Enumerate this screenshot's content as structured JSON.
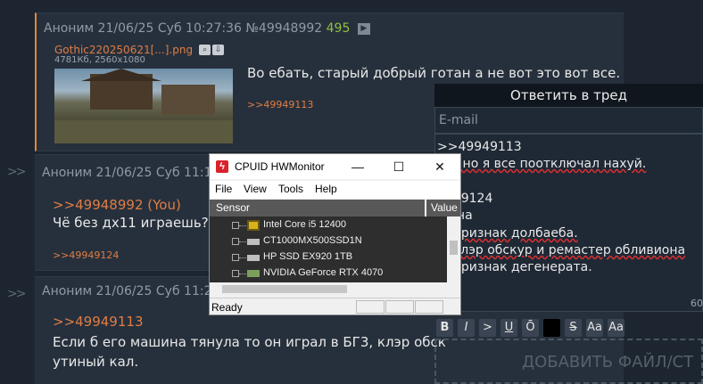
{
  "posts": [
    {
      "header": "Аноним 21/06/25 Суб 10:27:36 №49948992",
      "count": "495",
      "play_icon": "play-icon",
      "file_name": "Gothic220250621[...].png",
      "file_meta": "4781Кб, 2560x1080",
      "message": "Во ебать, старый добрый готан а не вот это вот все.",
      "backlink": ">>49949113"
    },
    {
      "header": "Аноним 21/06/25 Суб 11:16",
      "reply_link": ">>49948992 (You)",
      "message": "Чё без дх11 играешь?",
      "backlink": ">>49949124"
    },
    {
      "header": "Аноним 21/06/25 Суб 11:21",
      "reply_link": ">>49949113",
      "message_line1": "Если б его машина тянула то он играл в БГ3, клэр обск",
      "message_line2": "утиный кал."
    }
  ],
  "reply_form": {
    "title": "Ответить в тред",
    "email_placeholder": "E-mail",
    "text_lines": [
      ">>49949113",
      "им, но я все поотключал нахуй.",
      "",
      "9949124",
      "шина",
      "% признак долбаеба.",
      "3, клэр обскур и ремастер обливиона",
      "% признак дегенерата."
    ],
    "counter": "60",
    "toolbar": [
      "B",
      "I",
      ">",
      "U",
      "Ō",
      "■",
      "S",
      "Aa",
      "Aa"
    ],
    "dropzone": "ДОБАВИТЬ ФАЙЛ/СТ"
  },
  "hwmonitor": {
    "title": "CPUID HWMonitor",
    "menu": [
      "File",
      "View",
      "Tools",
      "Help"
    ],
    "columns": [
      "Sensor",
      "Value"
    ],
    "devices": [
      {
        "name": "Intel Core i5 12400",
        "icon": "cpu-icon"
      },
      {
        "name": "CT1000MX500SSD1N",
        "icon": "drive-icon"
      },
      {
        "name": "HP SSD EX920 1TB",
        "icon": "drive-icon"
      },
      {
        "name": "NVIDIA GeForce RTX 4070",
        "icon": "gpu-icon"
      }
    ],
    "status": "Ready",
    "controls": {
      "minimize": "—",
      "maximize": "☐",
      "close": "✕"
    }
  }
}
